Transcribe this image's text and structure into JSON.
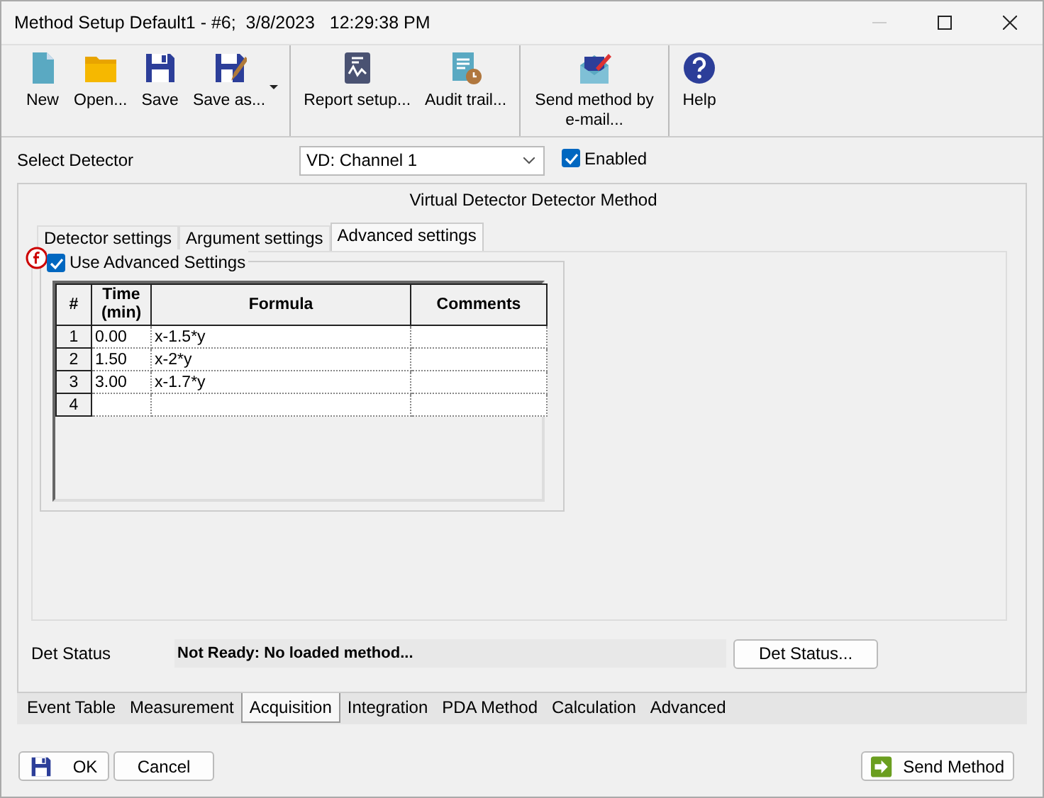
{
  "window": {
    "title": "Method Setup Default1 - #6;  3/8/2023   12:29:38 PM"
  },
  "toolbar": {
    "groups": [
      [
        {
          "label": "New",
          "kind": "new",
          "has_menu": false
        },
        {
          "label": "Open...",
          "kind": "open",
          "has_menu": false
        },
        {
          "label": "Save",
          "kind": "save",
          "has_menu": false
        },
        {
          "label": "Save as...",
          "kind": "saveas",
          "has_menu": true
        }
      ],
      [
        {
          "label": "Report setup...",
          "kind": "report",
          "has_menu": false
        },
        {
          "label": "Audit trail...",
          "kind": "audit",
          "has_menu": false
        }
      ],
      [
        {
          "label": "Send method by e-mail...",
          "kind": "mail",
          "has_menu": false
        }
      ],
      [
        {
          "label": "Help",
          "kind": "help",
          "has_menu": false
        }
      ]
    ]
  },
  "detector": {
    "label": "Select Detector",
    "value": "VD: Channel 1",
    "enabled_label": "Enabled",
    "enabled": true
  },
  "panel": {
    "title": "Virtual Detector Detector Method",
    "tabs": [
      {
        "label": "Detector settings",
        "selected": false
      },
      {
        "label": "Argument settings",
        "selected": false
      },
      {
        "label": "Advanced settings",
        "selected": true
      }
    ],
    "use_advanced": {
      "label": "Use Advanced Settings",
      "checked": true
    },
    "table": {
      "columns": [
        "#",
        "Time (min)",
        "Formula",
        "Comments"
      ],
      "rows": [
        [
          "1",
          "0.00",
          "x-1.5*y"
        ],
        [
          "2",
          "1.50",
          "x-2*y"
        ],
        [
          "3",
          "3.00",
          "x-1.7*y"
        ],
        [
          "4"
        ]
      ]
    }
  },
  "det_status": {
    "label": "Det Status",
    "value": "Not Ready: No loaded method...",
    "button": "Det Status..."
  },
  "bottom_tabs": [
    {
      "label": "Event Table",
      "selected": false
    },
    {
      "label": "Measurement",
      "selected": false
    },
    {
      "label": "Acquisition",
      "selected": true
    },
    {
      "label": "Integration",
      "selected": false
    },
    {
      "label": "PDA Method",
      "selected": false
    },
    {
      "label": "Calculation",
      "selected": false
    },
    {
      "label": "Advanced",
      "selected": false
    }
  ],
  "buttons": [
    {
      "label": "OK",
      "kind": "ok"
    },
    {
      "label": "Cancel",
      "kind": "plain"
    },
    {
      "label": "Send Method",
      "kind": "send"
    }
  ]
}
